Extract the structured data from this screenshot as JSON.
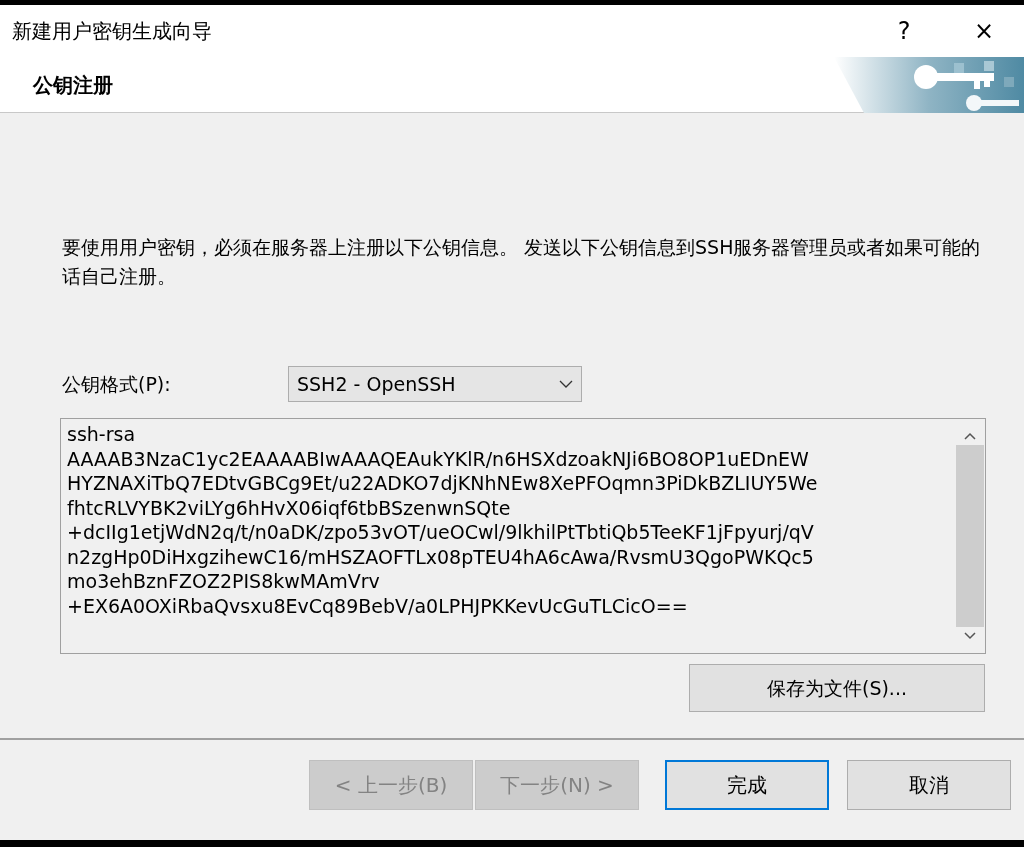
{
  "window": {
    "title": "新建用户密钥生成向导",
    "help": "?",
    "close": "×"
  },
  "header": {
    "title": "公钥注册"
  },
  "description": "要使用用户密钥，必须在服务器上注册以下公钥信息。 发送以下公钥信息到SSH服务器管理员或者如果可能的话自己注册。",
  "format": {
    "label": "公钥格式(P):",
    "value": "SSH2 - OpenSSH"
  },
  "key_lines": [
    "ssh-rsa",
    "AAAAB3NzaC1yc2EAAAABIwAAAQEAukYKlR/n6HSXdzoakNJi6BO8OP1uEDnEW",
    "HYZNAXiTbQ7EDtvGBCg9Et/u22ADKO7djKNhNEw8XePFOqmn3PiDkBZLIUY5We",
    "fhtcRLVYBK2viLYg6hHvX06iqf6tbBSzenwnSQte",
    "+dcIIg1etjWdN2q/t/n0aDK/zpo53vOT/ueOCwl/9lkhilPtTbtiQb5TeeKF1jFpyurj/qV",
    "n2zgHp0DiHxgzihewC16/mHSZAOFTLx08pTEU4hA6cAwa/RvsmU3QgoPWKQc5",
    "mo3ehBznFZOZ2PIS8kwMAmVrv",
    "+EX6A0OXiRbaQvsxu8EvCq89BebV/a0LPHJPKKevUcGuTLCicO=="
  ],
  "save_button": {
    "label": "保存为文件(S)..."
  },
  "buttons": [
    {
      "label": "< 上一步(B)",
      "disabled": true,
      "selected": false
    },
    {
      "label": "下一步(N) >",
      "disabled": true,
      "selected": false
    },
    {
      "label": "完成",
      "disabled": false,
      "selected": true
    },
    {
      "label": "取消",
      "disabled": false,
      "selected": false
    }
  ]
}
